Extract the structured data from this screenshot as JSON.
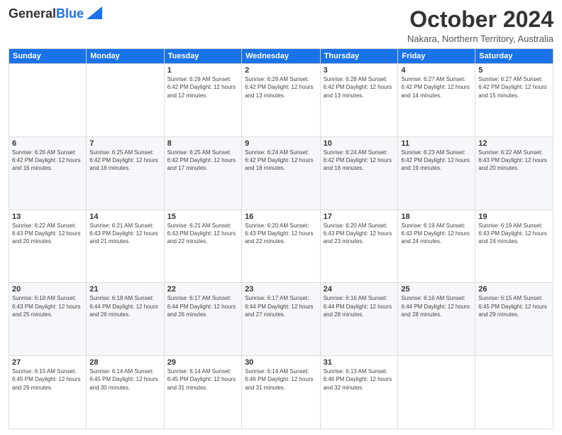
{
  "header": {
    "logo_line1": "General",
    "logo_line2": "Blue",
    "month": "October 2024",
    "location": "Nakara, Northern Territory, Australia"
  },
  "weekdays": [
    "Sunday",
    "Monday",
    "Tuesday",
    "Wednesday",
    "Thursday",
    "Friday",
    "Saturday"
  ],
  "weeks": [
    [
      {
        "day": "",
        "info": ""
      },
      {
        "day": "",
        "info": ""
      },
      {
        "day": "1",
        "info": "Sunrise: 6:29 AM\nSunset: 6:42 PM\nDaylight: 12 hours\nand 12 minutes."
      },
      {
        "day": "2",
        "info": "Sunrise: 6:29 AM\nSunset: 6:42 PM\nDaylight: 12 hours\nand 13 minutes."
      },
      {
        "day": "3",
        "info": "Sunrise: 6:28 AM\nSunset: 6:42 PM\nDaylight: 12 hours\nand 13 minutes."
      },
      {
        "day": "4",
        "info": "Sunrise: 6:27 AM\nSunset: 6:42 PM\nDaylight: 12 hours\nand 14 minutes."
      },
      {
        "day": "5",
        "info": "Sunrise: 6:27 AM\nSunset: 6:42 PM\nDaylight: 12 hours\nand 15 minutes."
      }
    ],
    [
      {
        "day": "6",
        "info": "Sunrise: 6:26 AM\nSunset: 6:42 PM\nDaylight: 12 hours\nand 16 minutes."
      },
      {
        "day": "7",
        "info": "Sunrise: 6:25 AM\nSunset: 6:42 PM\nDaylight: 12 hours\nand 16 minutes."
      },
      {
        "day": "8",
        "info": "Sunrise: 6:25 AM\nSunset: 6:42 PM\nDaylight: 12 hours\nand 17 minutes."
      },
      {
        "day": "9",
        "info": "Sunrise: 6:24 AM\nSunset: 6:42 PM\nDaylight: 12 hours\nand 18 minutes."
      },
      {
        "day": "10",
        "info": "Sunrise: 6:24 AM\nSunset: 6:42 PM\nDaylight: 12 hours\nand 18 minutes."
      },
      {
        "day": "11",
        "info": "Sunrise: 6:23 AM\nSunset: 6:42 PM\nDaylight: 12 hours\nand 19 minutes."
      },
      {
        "day": "12",
        "info": "Sunrise: 6:22 AM\nSunset: 6:43 PM\nDaylight: 12 hours\nand 20 minutes."
      }
    ],
    [
      {
        "day": "13",
        "info": "Sunrise: 6:22 AM\nSunset: 6:43 PM\nDaylight: 12 hours\nand 20 minutes."
      },
      {
        "day": "14",
        "info": "Sunrise: 6:21 AM\nSunset: 6:43 PM\nDaylight: 12 hours\nand 21 minutes."
      },
      {
        "day": "15",
        "info": "Sunrise: 6:21 AM\nSunset: 6:43 PM\nDaylight: 12 hours\nand 22 minutes."
      },
      {
        "day": "16",
        "info": "Sunrise: 6:20 AM\nSunset: 6:43 PM\nDaylight: 12 hours\nand 22 minutes."
      },
      {
        "day": "17",
        "info": "Sunrise: 6:20 AM\nSunset: 6:43 PM\nDaylight: 12 hours\nand 23 minutes."
      },
      {
        "day": "18",
        "info": "Sunrise: 6:19 AM\nSunset: 6:43 PM\nDaylight: 12 hours\nand 24 minutes."
      },
      {
        "day": "19",
        "info": "Sunrise: 6:19 AM\nSunset: 6:43 PM\nDaylight: 12 hours\nand 24 minutes."
      }
    ],
    [
      {
        "day": "20",
        "info": "Sunrise: 6:18 AM\nSunset: 6:43 PM\nDaylight: 12 hours\nand 25 minutes."
      },
      {
        "day": "21",
        "info": "Sunrise: 6:18 AM\nSunset: 6:44 PM\nDaylight: 12 hours\nand 26 minutes."
      },
      {
        "day": "22",
        "info": "Sunrise: 6:17 AM\nSunset: 6:44 PM\nDaylight: 12 hours\nand 26 minutes."
      },
      {
        "day": "23",
        "info": "Sunrise: 6:17 AM\nSunset: 6:44 PM\nDaylight: 12 hours\nand 27 minutes."
      },
      {
        "day": "24",
        "info": "Sunrise: 6:16 AM\nSunset: 6:44 PM\nDaylight: 12 hours\nand 28 minutes."
      },
      {
        "day": "25",
        "info": "Sunrise: 6:16 AM\nSunset: 6:44 PM\nDaylight: 12 hours\nand 28 minutes."
      },
      {
        "day": "26",
        "info": "Sunrise: 6:15 AM\nSunset: 6:45 PM\nDaylight: 12 hours\nand 29 minutes."
      }
    ],
    [
      {
        "day": "27",
        "info": "Sunrise: 6:15 AM\nSunset: 6:45 PM\nDaylight: 12 hours\nand 29 minutes."
      },
      {
        "day": "28",
        "info": "Sunrise: 6:14 AM\nSunset: 6:45 PM\nDaylight: 12 hours\nand 30 minutes."
      },
      {
        "day": "29",
        "info": "Sunrise: 6:14 AM\nSunset: 6:45 PM\nDaylight: 12 hours\nand 31 minutes."
      },
      {
        "day": "30",
        "info": "Sunrise: 6:14 AM\nSunset: 6:46 PM\nDaylight: 12 hours\nand 31 minutes."
      },
      {
        "day": "31",
        "info": "Sunrise: 6:13 AM\nSunset: 6:46 PM\nDaylight: 12 hours\nand 32 minutes."
      },
      {
        "day": "",
        "info": ""
      },
      {
        "day": "",
        "info": ""
      }
    ]
  ]
}
